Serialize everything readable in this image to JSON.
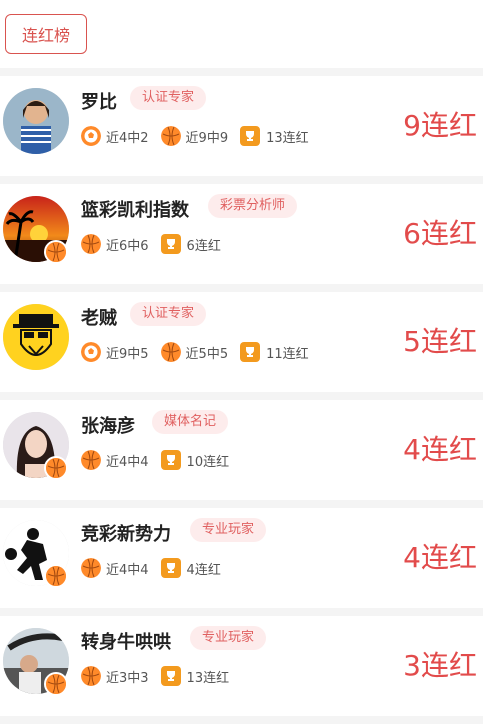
{
  "header": {
    "tab_label": "连红榜"
  },
  "colors": {
    "accent": "#e24b4b",
    "tag_bg": "#fdecec",
    "trophy": "#f39a1e",
    "ball": "#ff8a2a"
  },
  "rows": [
    {
      "name": "罗比",
      "tag": "认证专家",
      "stats": [
        {
          "icon": "football-icon",
          "text": "近4中2"
        },
        {
          "icon": "basketball-icon",
          "text": "近9中9"
        },
        {
          "icon": "trophy-icon",
          "text": "13连红"
        }
      ],
      "streak": "9连红",
      "badge": false
    },
    {
      "name": "篮彩凯利指数",
      "tag": "彩票分析师",
      "stats": [
        {
          "icon": "basketball-icon",
          "text": "近6中6"
        },
        {
          "icon": "trophy-icon",
          "text": "6连红"
        }
      ],
      "streak": "6连红",
      "badge": true
    },
    {
      "name": "老贼",
      "tag": "认证专家",
      "stats": [
        {
          "icon": "football-icon",
          "text": "近9中5"
        },
        {
          "icon": "basketball-icon",
          "text": "近5中5"
        },
        {
          "icon": "trophy-icon",
          "text": "11连红"
        }
      ],
      "streak": "5连红",
      "badge": false
    },
    {
      "name": "张海彦",
      "tag": "媒体名记",
      "stats": [
        {
          "icon": "basketball-icon",
          "text": "近4中4"
        },
        {
          "icon": "trophy-icon",
          "text": "10连红"
        }
      ],
      "streak": "4连红",
      "badge": true
    },
    {
      "name": "竞彩新势力",
      "tag": "专业玩家",
      "stats": [
        {
          "icon": "basketball-icon",
          "text": "近4中4"
        },
        {
          "icon": "trophy-icon",
          "text": "4连红"
        }
      ],
      "streak": "4连红",
      "badge": true
    },
    {
      "name": "转身牛哄哄",
      "tag": "专业玩家",
      "stats": [
        {
          "icon": "basketball-icon",
          "text": "近3中3"
        },
        {
          "icon": "trophy-icon",
          "text": "13连红"
        }
      ],
      "streak": "3连红",
      "badge": true
    }
  ]
}
